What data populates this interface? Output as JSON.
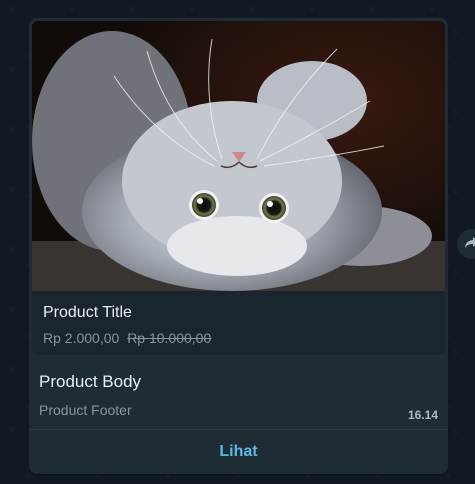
{
  "message": {
    "product": {
      "image_alt": "kitten lying upside down",
      "title": "Product Title",
      "price": "Rp 2.000,00",
      "original_price": "Rp 10.000,00"
    },
    "body": "Product Body",
    "footer": "Product Footer",
    "time": "16.14",
    "action_label": "Lihat"
  },
  "icons": {
    "forward": "forward-icon"
  },
  "colors": {
    "bubble": "#1f2c34",
    "link": "#53bdeb",
    "text_primary": "#e9edef",
    "text_secondary": "#8696a0"
  }
}
